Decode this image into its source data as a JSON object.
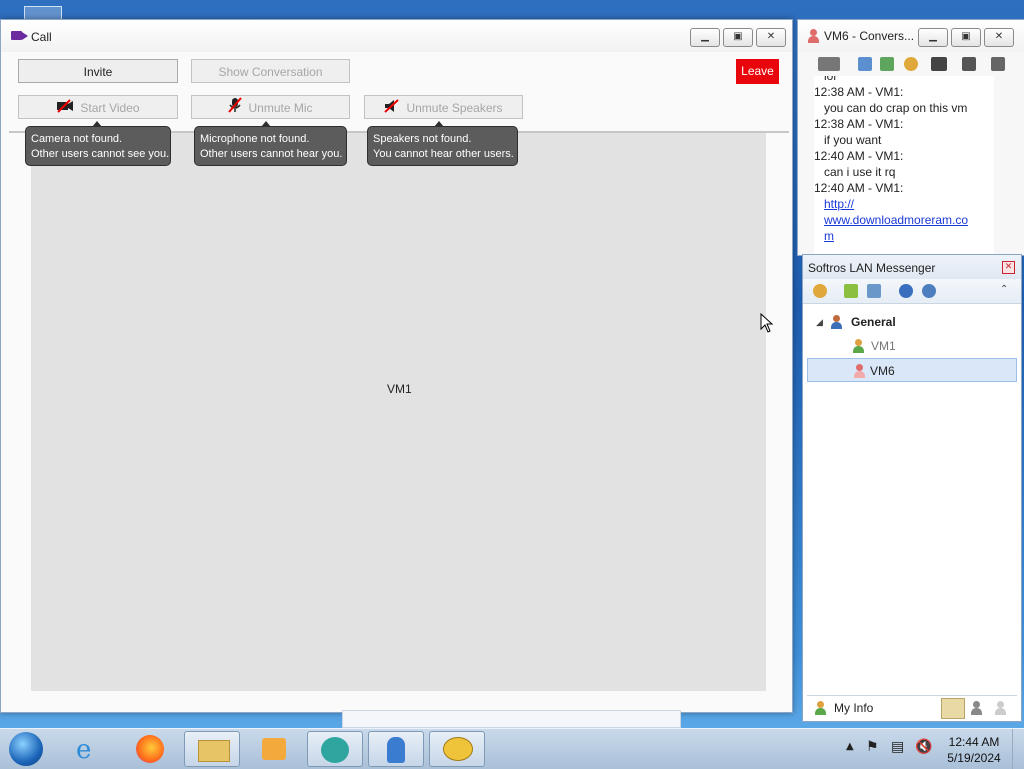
{
  "call_window": {
    "title": "Call",
    "buttons": {
      "invite": "Invite",
      "show_conversation": "Show Conversation",
      "leave": "Leave",
      "start_video": "Start Video",
      "unmute_mic": "Unmute Mic",
      "unmute_speakers": "Unmute Speakers"
    },
    "tooltips": {
      "camera_line1": "Camera not found.",
      "camera_line2": "Other users cannot see you.",
      "mic_line1": "Microphone not found.",
      "mic_line2": "Other users cannot hear you.",
      "speakers_line1": "Speakers not found.",
      "speakers_line2": "You cannot hear other users."
    },
    "participant": "VM1"
  },
  "conversation_window": {
    "title": "VM6 - Convers...",
    "messages": [
      {
        "kind": "msg",
        "text": "lol"
      },
      {
        "kind": "header",
        "text": "12:38 AM - VM1:"
      },
      {
        "kind": "msg",
        "text": "you can do crap on this vm"
      },
      {
        "kind": "header",
        "text": "12:38 AM - VM1:"
      },
      {
        "kind": "msg",
        "text": "if you want"
      },
      {
        "kind": "header",
        "text": "12:40 AM - VM1:"
      },
      {
        "kind": "msg",
        "text": "can i use it rq"
      },
      {
        "kind": "header",
        "text": "12:40 AM - VM1:"
      },
      {
        "kind": "link",
        "text": "http://"
      },
      {
        "kind": "link",
        "text": "www.downloadmoreram.co"
      },
      {
        "kind": "link",
        "text": "m"
      }
    ]
  },
  "lan_messenger": {
    "title": "Softros LAN Messenger",
    "group": "General",
    "users": [
      {
        "name": "VM1",
        "status": "online"
      },
      {
        "name": "VM6",
        "status": "selected"
      }
    ],
    "my_info": "My Info"
  },
  "taskbar": {
    "time": "12:44 AM",
    "date": "5/19/2024"
  },
  "colors": {
    "leave_button": "#e8050b",
    "link": "#1a38d6",
    "tooltip_bg": "#5c5c5c",
    "selection": "#d9e7f8"
  }
}
